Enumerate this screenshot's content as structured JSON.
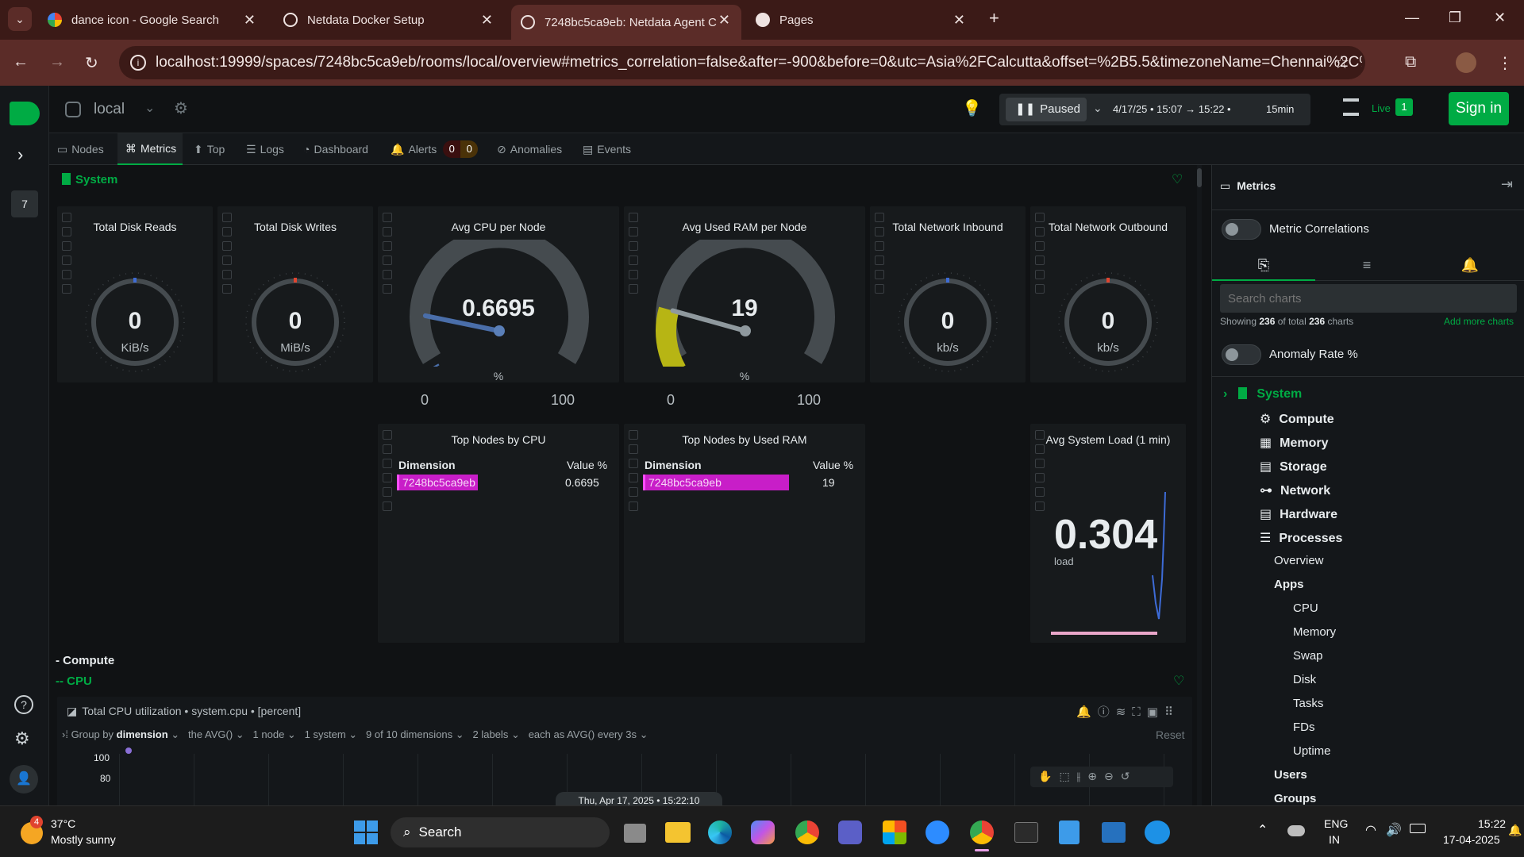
{
  "browser": {
    "tabs": [
      {
        "title": "dance icon - Google Search"
      },
      {
        "title": "Netdata Docker Setup"
      },
      {
        "title": "7248bc5ca9eb: Netdata Agent C"
      },
      {
        "title": "Pages"
      }
    ],
    "url": "localhost:19999/spaces/7248bc5ca9eb/rooms/local/overview#metrics_correlation=false&after=-900&before=0&utc=Asia%2FCalcutta&offset=%2B5.5&timezoneName=Chennai%2C%20Kolkat..."
  },
  "header": {
    "room": "local",
    "paused_label": "Paused",
    "time_range": "4/17/25 • 15:07 → 15:22 •",
    "duration": "15min",
    "live_label": "Live",
    "live_count": "1",
    "signin_label": "Sign in"
  },
  "rail": {
    "badge": "7"
  },
  "navtabs": {
    "nodes": "Nodes",
    "metrics": "Metrics",
    "top": "Top",
    "logs": "Logs",
    "dashboard": "Dashboard",
    "alerts": "Alerts",
    "alerts_crit": "0",
    "alerts_warn": "0",
    "anomalies": "Anomalies",
    "events": "Events"
  },
  "section": {
    "title": "System"
  },
  "gauges": [
    {
      "title": "Total Disk Reads",
      "value": "0",
      "unit": "KiB/s"
    },
    {
      "title": "Total Disk Writes",
      "value": "0",
      "unit": "MiB/s"
    },
    {
      "title": "Avg CPU per Node",
      "value": "0.6695",
      "unit": "%",
      "min": "0",
      "max": "100"
    },
    {
      "title": "Avg Used RAM per Node",
      "value": "19",
      "unit": "%",
      "min": "0",
      "max": "100"
    },
    {
      "title": "Total Network Inbound",
      "value": "0",
      "unit": "kb/s"
    },
    {
      "title": "Total Network Outbound",
      "value": "0",
      "unit": "kb/s"
    }
  ],
  "gauge_levels": {
    "cpu_percent": 0.6695,
    "ram_percent": 19
  },
  "top_cpu": {
    "title": "Top Nodes by CPU",
    "col1": "Dimension",
    "col2": "Value %",
    "node": "7248bc5ca9eb",
    "value": "0.6695"
  },
  "top_ram": {
    "title": "Top Nodes by Used RAM",
    "col1": "Dimension",
    "col2": "Value %",
    "node": "7248bc5ca9eb",
    "value": "19"
  },
  "load": {
    "title": "Avg System Load (1 min)",
    "value": "0.304",
    "unit": "load"
  },
  "compute": {
    "heading": "- Compute",
    "sub": "-- CPU",
    "chart_title": "Total CPU utilization • system.cpu • [percent]",
    "group_by": "Group by",
    "group_by_val": "dimension",
    "agg": "the AVG()",
    "nodes": "1 node",
    "systems": "1 system",
    "dims": "9 of 10 dimensions",
    "labels": "2 labels",
    "each": "each as AVG() every 3s",
    "reset": "Reset",
    "y100": "100",
    "y80": "80",
    "timestamp": "Thu, Apr 17, 2025 • 15:22:10"
  },
  "rpanel": {
    "title": "Metrics",
    "metric_corr": "Metric Correlations",
    "search_placeholder": "Search charts",
    "showing_pre": "Showing",
    "showing_a": "236",
    "showing_mid": "of total",
    "showing_b": "236",
    "showing_post": "charts",
    "add_more": "Add more charts",
    "anomaly": "Anomaly Rate %",
    "tree": {
      "system": "System",
      "compute": "Compute",
      "memory": "Memory",
      "storage": "Storage",
      "network": "Network",
      "hardware": "Hardware",
      "processes": "Processes",
      "overview": "Overview",
      "apps": "Apps",
      "cpu": "CPU",
      "memory2": "Memory",
      "swap": "Swap",
      "disk": "Disk",
      "tasks": "Tasks",
      "fds": "FDs",
      "uptime": "Uptime",
      "users": "Users",
      "groups": "Groups"
    }
  },
  "taskbar": {
    "weather_temp": "37°C",
    "weather_desc": "Mostly sunny",
    "weather_badge": "4",
    "search": "Search",
    "lang1": "ENG",
    "lang2": "IN",
    "time": "15:22",
    "date": "17-04-2025"
  },
  "colors": {
    "accent": "#00ab44",
    "tab_bg": "#3b1a17",
    "addr_bg": "#5b2c28",
    "magenta": "#c81ec8",
    "ram_gauge": "#b7b514",
    "cpu_needle": "#4a6ea9"
  }
}
